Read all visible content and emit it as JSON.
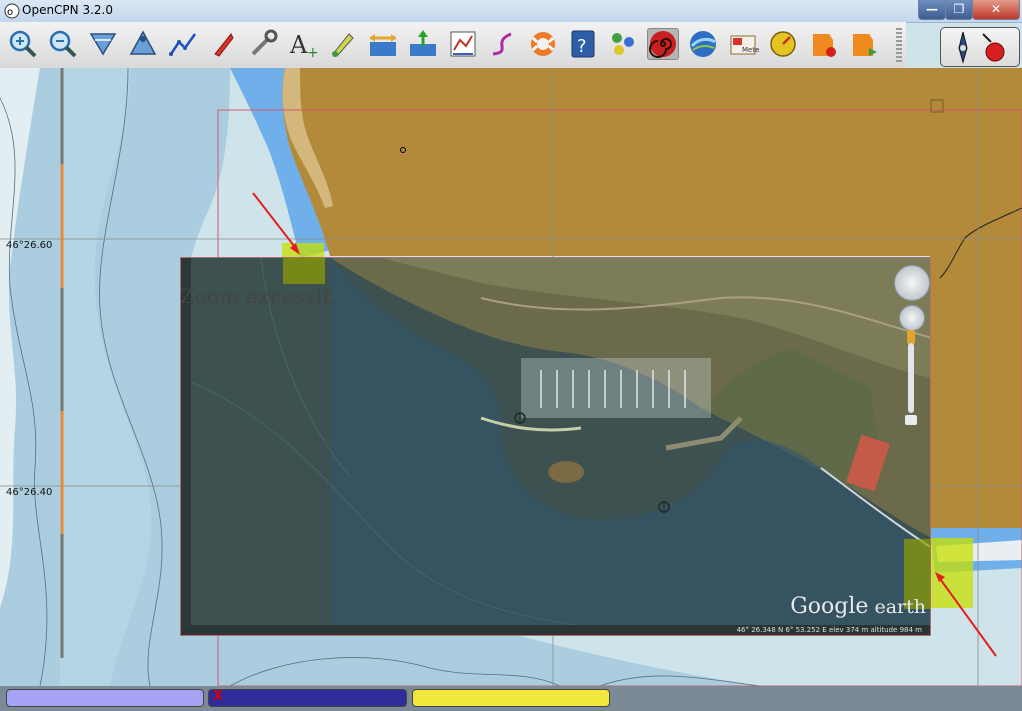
{
  "window": {
    "title": "OpenCPN 3.2.0",
    "minimize_glyph": "—",
    "maximize_glyph": "❐",
    "close_glyph": "✕"
  },
  "toolbar": {
    "tools": [
      {
        "name": "zoom-in-icon"
      },
      {
        "name": "zoom-out-icon"
      },
      {
        "name": "scale-in-icon"
      },
      {
        "name": "scale-out-icon"
      },
      {
        "name": "route-icon"
      },
      {
        "name": "follow-ship-icon"
      },
      {
        "name": "settings-icon"
      },
      {
        "name": "text-icon"
      },
      {
        "name": "current-icon"
      },
      {
        "name": "tide-icon"
      },
      {
        "name": "tide-low-icon"
      },
      {
        "name": "route-manager-icon"
      },
      {
        "name": "track-icon"
      },
      {
        "name": "mob-icon"
      },
      {
        "name": "help-icon"
      },
      {
        "name": "layers-icon"
      },
      {
        "name": "spiral-plugin-icon"
      },
      {
        "name": "google-earth-icon"
      },
      {
        "name": "weather-icon"
      },
      {
        "name": "dashboard-icon"
      },
      {
        "name": "record-icon"
      },
      {
        "name": "play-icon"
      }
    ],
    "active_tool": "spiral-plugin-icon"
  },
  "chart": {
    "latitude_labels": [
      "46°26.60",
      "46°26.40"
    ],
    "overlay_message": "Zoom excessif."
  },
  "google_earth": {
    "logo_main": "Google",
    "logo_sub": " earth",
    "status": "46° 26.348 N   6° 53.252 E   elev  374 m     altitude  984 m"
  },
  "statusbar": {
    "marker": "X",
    "colors": [
      "#a6a3f6",
      "#2f2b9a",
      "#f0e83c"
    ]
  },
  "colors": {
    "land": "#b38a3a",
    "shallow": "#6fb0ea",
    "medium_water": "#aacde0",
    "deep_water": "#cfe3ea",
    "highlight": "#c8e000"
  }
}
